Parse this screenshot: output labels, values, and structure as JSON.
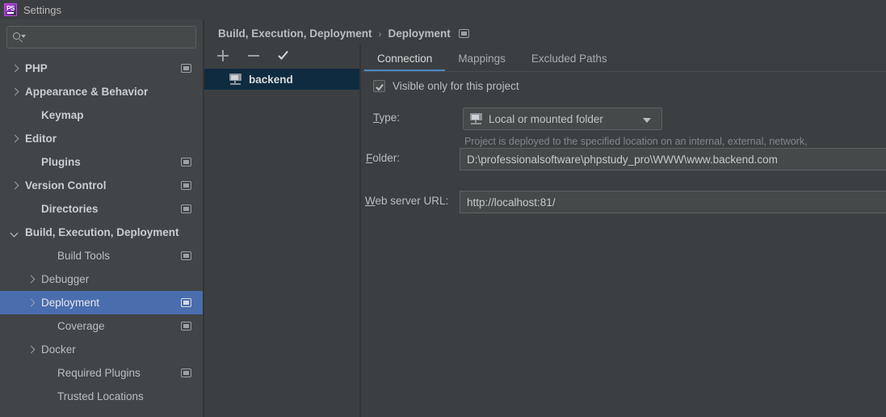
{
  "window": {
    "title": "Settings",
    "app_icon": "phpstorm-logo-icon"
  },
  "search": {
    "value": "",
    "placeholder": "",
    "icon": "search-icon"
  },
  "sidebar": {
    "items": [
      {
        "label": "PHP",
        "arrow": "right",
        "indent": 1,
        "bold": true,
        "scope_icon": true,
        "selected": false
      },
      {
        "label": "Appearance & Behavior",
        "arrow": "right",
        "indent": 1,
        "bold": true,
        "scope_icon": false,
        "selected": false
      },
      {
        "label": "Keymap",
        "arrow": "none",
        "indent": 2,
        "bold": true,
        "scope_icon": false,
        "selected": false
      },
      {
        "label": "Editor",
        "arrow": "right",
        "indent": 1,
        "bold": true,
        "scope_icon": false,
        "selected": false
      },
      {
        "label": "Plugins",
        "arrow": "none",
        "indent": 2,
        "bold": true,
        "scope_icon": true,
        "selected": false
      },
      {
        "label": "Version Control",
        "arrow": "right",
        "indent": 1,
        "bold": true,
        "scope_icon": true,
        "selected": false
      },
      {
        "label": "Directories",
        "arrow": "none",
        "indent": 2,
        "bold": true,
        "scope_icon": true,
        "selected": false
      },
      {
        "label": "Build, Execution, Deployment",
        "arrow": "down",
        "indent": 1,
        "bold": true,
        "scope_icon": false,
        "selected": false
      },
      {
        "label": "Build Tools",
        "arrow": "none",
        "indent": 3,
        "bold": false,
        "scope_icon": true,
        "selected": false
      },
      {
        "label": "Debugger",
        "arrow": "right",
        "indent": 2,
        "bold": false,
        "scope_icon": false,
        "selected": false
      },
      {
        "label": "Deployment",
        "arrow": "right",
        "indent": 2,
        "bold": false,
        "scope_icon": true,
        "selected": true
      },
      {
        "label": "Coverage",
        "arrow": "none",
        "indent": 3,
        "bold": false,
        "scope_icon": true,
        "selected": false
      },
      {
        "label": "Docker",
        "arrow": "right",
        "indent": 2,
        "bold": false,
        "scope_icon": false,
        "selected": false
      },
      {
        "label": "Required Plugins",
        "arrow": "none",
        "indent": 3,
        "bold": false,
        "scope_icon": true,
        "selected": false
      },
      {
        "label": "Trusted Locations",
        "arrow": "none",
        "indent": 3,
        "bold": false,
        "scope_icon": false,
        "selected": false
      }
    ]
  },
  "breadcrumb": {
    "parent": "Build, Execution, Deployment",
    "separator": "›",
    "current": "Deployment"
  },
  "server_panel": {
    "toolbar": {
      "add_label": "+",
      "remove_label": "−",
      "set_default_label": "✓"
    },
    "servers": [
      {
        "name": "backend",
        "icon": "server-icon",
        "selected": true
      }
    ]
  },
  "tabs": [
    {
      "label": "Connection",
      "active": true
    },
    {
      "label": "Mappings",
      "active": false
    },
    {
      "label": "Excluded Paths",
      "active": false
    }
  ],
  "connection": {
    "visible_only_checkbox": {
      "label": "Visible only for this project",
      "checked": true
    },
    "type": {
      "label": "Type:",
      "mnemonic": "T",
      "value": "Local or mounted folder",
      "icon": "local-folder-server-icon",
      "description": "Project is deployed to the specified location on an internal, external, network, or mounted drive."
    },
    "folder": {
      "label": "Folder:",
      "mnemonic": "F",
      "value": "D:\\professionalsoftware\\phpstudy_pro\\WWW\\www.backend.com",
      "placeholder": ""
    },
    "web_server_url": {
      "label": "Web server URL:",
      "mnemonic": "W",
      "value": "http://localhost:81/",
      "placeholder": ""
    }
  },
  "colors": {
    "window_bg": "#3c3f41",
    "sidebar_bg": "#414547",
    "selection_blue": "#4a6dae",
    "server_selection": "#0f2b40",
    "tab_accent": "#4a88c7",
    "text_primary": "#b9bec1",
    "text_muted": "#83888b",
    "field_bg": "#45494a"
  }
}
